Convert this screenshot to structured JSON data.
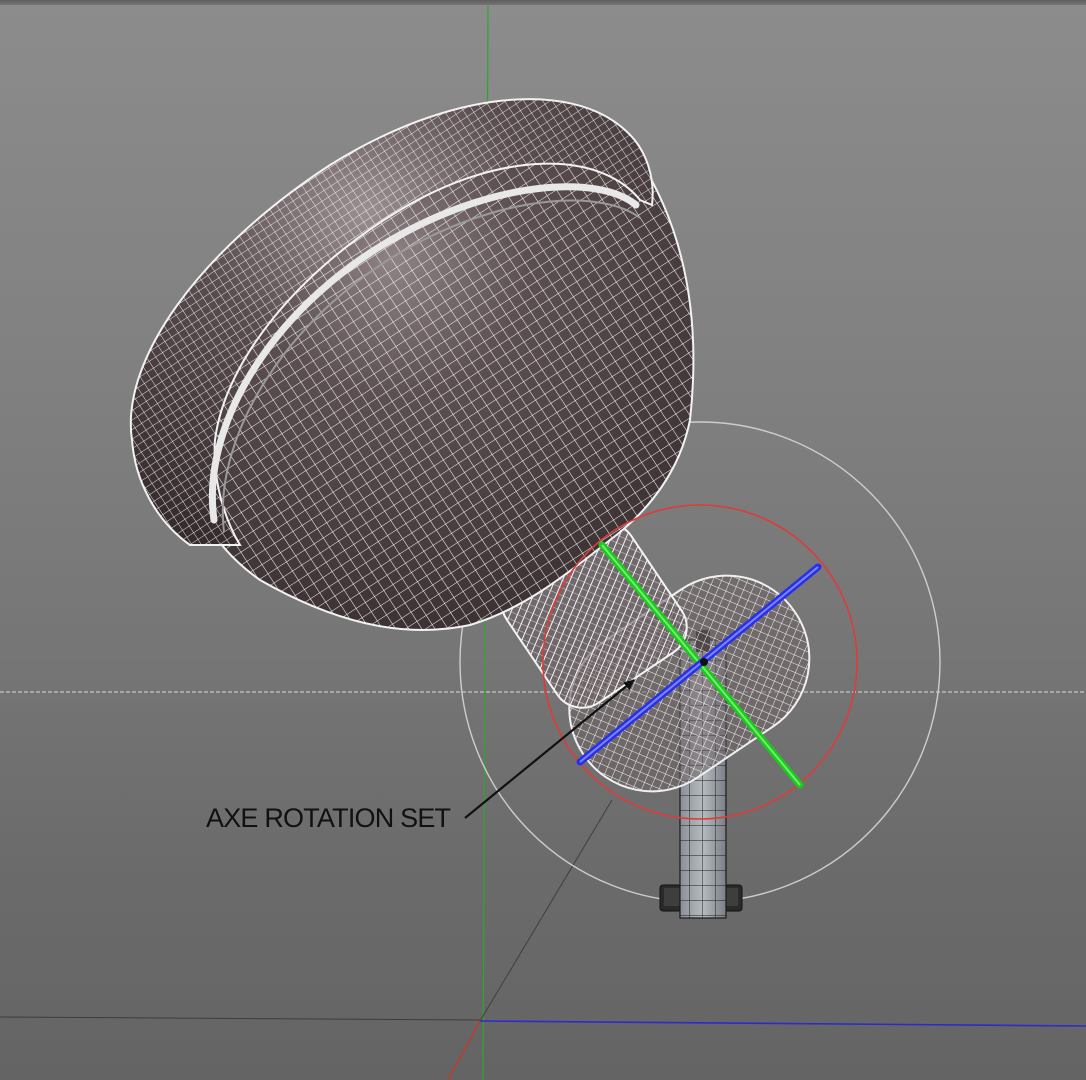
{
  "viewport": {
    "background": "#7e7e7e",
    "axis_colors": {
      "x": "#c23a2a",
      "y": "#2fae2f",
      "z": "#2828c8"
    }
  },
  "model": {
    "body_color": "#4a3e3f",
    "wire_color": "#f2f2f2",
    "gizmo_colors": {
      "green": "#22dd22",
      "blue": "#2c34ee",
      "ring": "#e43a3a",
      "outer_ring": "#cfcfcf"
    }
  },
  "annotation": {
    "label": "AXE ROTATION SET",
    "arrow_icon": "arrow-icon"
  }
}
